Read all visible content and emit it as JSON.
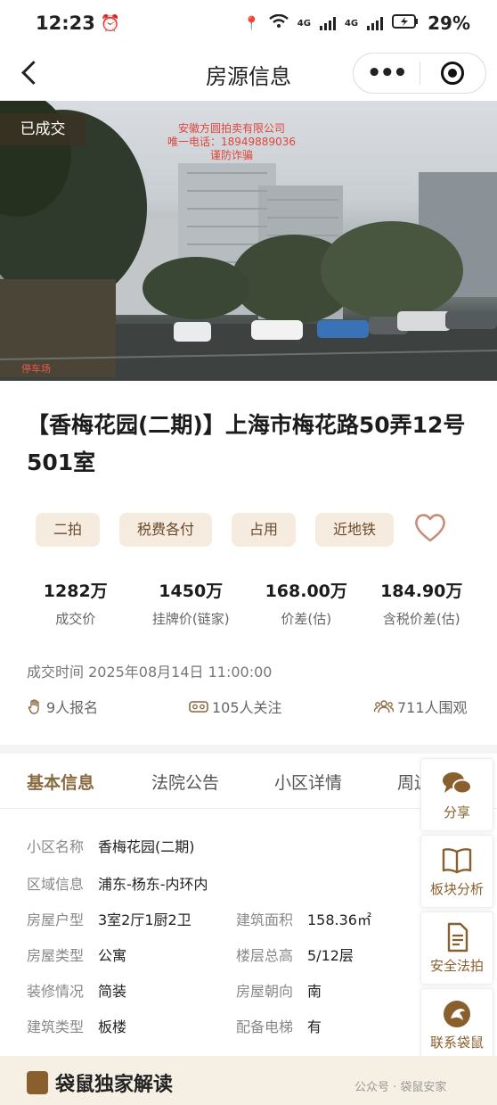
{
  "status": {
    "time": "12:23",
    "battery": "29%",
    "network_a": "4G",
    "network_b": "4G"
  },
  "nav": {
    "title": "房源信息",
    "more_label": "•••"
  },
  "hero": {
    "badge": "已成交",
    "watermark_lines": [
      "安徽方圆拍卖有限公司",
      "唯一电话：18949889036",
      "谨防诈骗"
    ],
    "sign": "停车场"
  },
  "listing": {
    "title": "【香梅花园(二期)】上海市梅花路50弄12号501室",
    "tags": [
      "二拍",
      "税费各付",
      "占用",
      "近地铁"
    ],
    "prices": [
      {
        "value": "1282万",
        "label": "成交价"
      },
      {
        "value": "1450万",
        "label": "挂牌价(链家)"
      },
      {
        "value": "168.00万",
        "label": "价差(估)"
      },
      {
        "value": "184.90万",
        "label": "含税价差(估)"
      }
    ],
    "deal_time": "成交时间 2025年08月14日 11:00:00",
    "signups": "9人报名",
    "followers": "105人关注",
    "watchers": "711人围观"
  },
  "tabs": [
    "基本信息",
    "法院公告",
    "小区详情",
    "周边"
  ],
  "info": {
    "community": {
      "k": "小区名称",
      "v": "香梅花园(二期)"
    },
    "region": {
      "k": "区域信息",
      "v": "浦东-杨东-内环内"
    },
    "layout": {
      "k": "房屋户型",
      "v": "3室2厅1厨2卫"
    },
    "area": {
      "k": "建筑面积",
      "v": "158.36㎡"
    },
    "type": {
      "k": "房屋类型",
      "v": "公寓"
    },
    "floor": {
      "k": "楼层总高",
      "v": "5/12层"
    },
    "decor": {
      "k": "装修情况",
      "v": "简装"
    },
    "orient": {
      "k": "房屋朝向",
      "v": "南"
    },
    "building": {
      "k": "建筑类型",
      "v": "板楼"
    },
    "elevator": {
      "k": "配备电梯",
      "v": "有"
    }
  },
  "side": [
    "分享",
    "板块分析",
    "安全法拍",
    "联系袋鼠"
  ],
  "bottom": {
    "exclusive": "袋鼠独家解读",
    "wechat": "公众号 · 袋鼠安家"
  },
  "colors": {
    "accent": "#8a5f2e",
    "tag_bg": "#f6ebdf",
    "heart": "#c98b7a"
  }
}
